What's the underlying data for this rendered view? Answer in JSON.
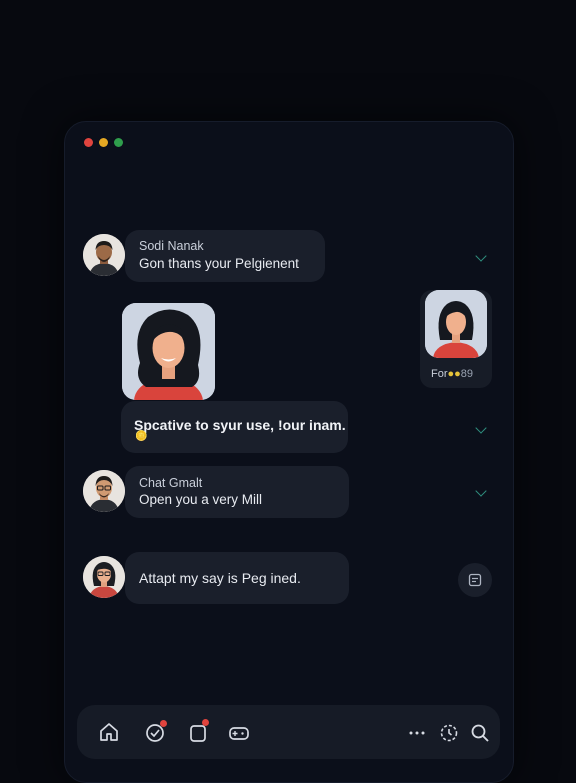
{
  "window_controls": [
    "close",
    "minimize",
    "maximize"
  ],
  "messages": [
    {
      "name": "Sodi Nanak",
      "text": "Gon thans your Pelgienent"
    },
    {
      "text": "Spcative to syur use, !our inam.",
      "emoji": "🪙"
    },
    {
      "name": "Chat Gmalt",
      "text": "Open you a very Mill"
    },
    {
      "text": "Attapt my say is Peg ined."
    }
  ],
  "mini_card": {
    "caption": "For",
    "dots": "●●",
    "count": "89"
  },
  "colors": {
    "background": "#07090f",
    "window": "#0b0f1a",
    "bubble": "#1a1f2b",
    "accent": "#2f8f7f",
    "badge": "#e0443e"
  },
  "bottom_bar": {
    "icons": [
      "home-icon",
      "activity-icon",
      "notes-icon",
      "gamepad-icon",
      "more-icon",
      "timer-icon",
      "search-icon"
    ]
  }
}
